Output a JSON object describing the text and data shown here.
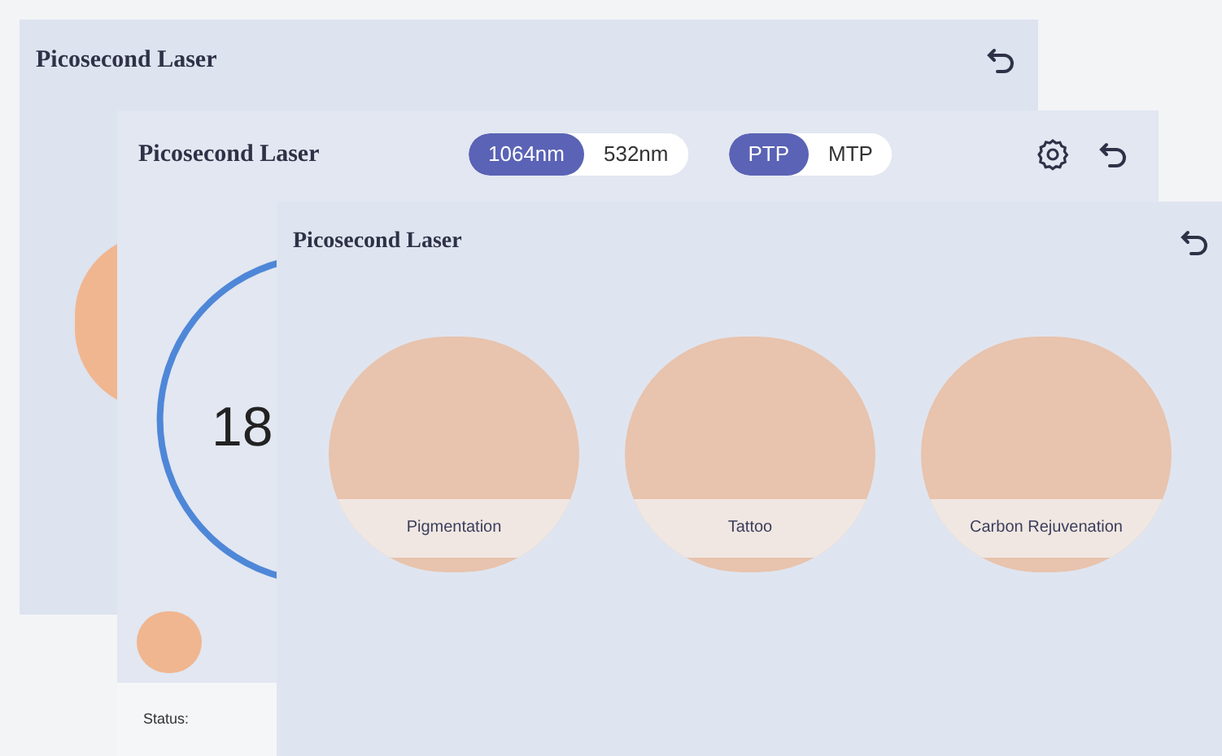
{
  "windows": [
    {
      "title": "Picosecond Laser"
    },
    {
      "title": "Picosecond Laser",
      "wavelengths": [
        {
          "label": "1064nm",
          "selected": true
        },
        {
          "label": "532nm",
          "selected": false
        }
      ],
      "modes": [
        {
          "label": "PTP",
          "selected": true
        },
        {
          "label": "MTP",
          "selected": false
        }
      ],
      "counter": "18",
      "status_label": "Status:"
    },
    {
      "title": "Picosecond Laser",
      "treatments": [
        {
          "label": "Pigmentation"
        },
        {
          "label": "Tattoo"
        },
        {
          "label": "Carbon Rejuvenation"
        }
      ]
    }
  ]
}
